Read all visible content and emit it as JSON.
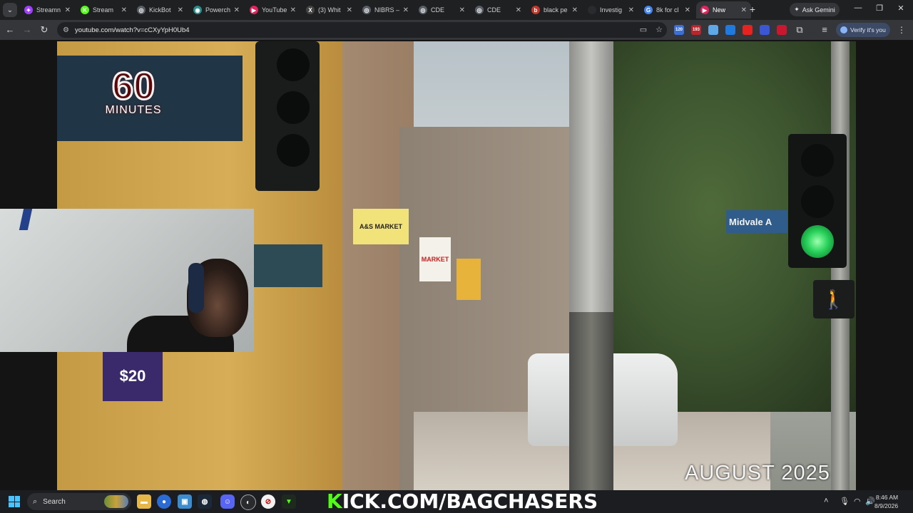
{
  "browser": {
    "tabs": [
      {
        "title": "Streamn",
        "color": "#a040ff",
        "glyph": "✦"
      },
      {
        "title": "Stream",
        "color": "#53fc18",
        "glyph": "K"
      },
      {
        "title": "KickBot",
        "color": "#5a5f66",
        "glyph": "◎"
      },
      {
        "title": "Powerch",
        "color": "#2c8c8c",
        "glyph": "◉"
      },
      {
        "title": "YouTube",
        "color": "#e0245e",
        "glyph": "▶"
      },
      {
        "title": "(3) Whit",
        "color": "#444",
        "glyph": "X"
      },
      {
        "title": "NIBRS –",
        "color": "#5a5f66",
        "glyph": "◎"
      },
      {
        "title": "CDE",
        "color": "#5a5f66",
        "glyph": "◎"
      },
      {
        "title": "CDE",
        "color": "#5a5f66",
        "glyph": "◎"
      },
      {
        "title": "black pe",
        "color": "#c0392b",
        "glyph": "b"
      },
      {
        "title": "Investig",
        "color": "#2a2b2e",
        "glyph": ""
      },
      {
        "title": "8k for cl",
        "color": "#4285f4",
        "glyph": "G"
      },
      {
        "title": "New",
        "color": "#e0245e",
        "glyph": "▶"
      }
    ],
    "ask_gemini": "Ask Gemini",
    "url": "youtube.com/watch?v=cCXyYpH0Ub4",
    "extensions": [
      {
        "label": "120",
        "color": "#3b6fd8"
      },
      {
        "label": "193",
        "color": "#b8262c"
      },
      {
        "label": "",
        "color": "#5fa8e8"
      },
      {
        "label": "",
        "color": "#1f7ae0"
      },
      {
        "label": "",
        "color": "#e52420"
      },
      {
        "label": "",
        "color": "#3c56d8"
      },
      {
        "label": "",
        "color": "#c8172f"
      }
    ],
    "verify_label": "Verify it's you"
  },
  "video": {
    "logo_number": "60",
    "logo_word": "MINUTES",
    "date_overlay": "AUGUST 2025",
    "street_sign": "Midvale A",
    "store_sign_1": "A&S MARKET",
    "store_sign_2": "MARKET",
    "price_sign": "$20"
  },
  "taskbar": {
    "search_label": "Search",
    "stream_banner_k": "K",
    "stream_banner_rest": "ICK.COM/BAGCHASERS",
    "time": "8:46 AM",
    "date": "8/9/2026"
  }
}
